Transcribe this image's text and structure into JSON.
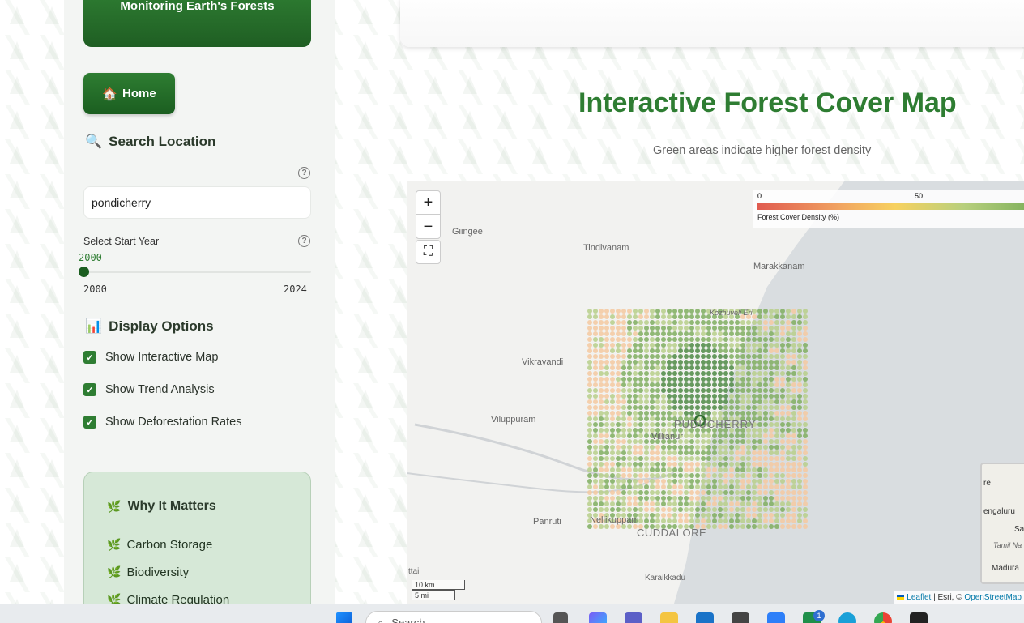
{
  "sidebar": {
    "brand_text": "Monitoring Earth's Forests",
    "home_button": {
      "icon": "house-icon",
      "label": "Home"
    },
    "search_section": {
      "icon": "magnifier-icon",
      "title": "Search Location",
      "value": "pondicherry"
    },
    "start_year": {
      "label": "Select Start Year",
      "value": "2000",
      "min": "2000",
      "max": "2024"
    },
    "display_options": {
      "icon": "bar-chart-icon",
      "title": "Display Options",
      "items": [
        {
          "label": "Show Interactive Map",
          "checked": true
        },
        {
          "label": "Show Trend Analysis",
          "checked": true
        },
        {
          "label": "Show Deforestation Rates",
          "checked": true
        }
      ]
    },
    "why_card": {
      "icon": "leaf-icon",
      "title": "Why It Matters",
      "items": [
        "Carbon Storage",
        "Biodiversity",
        "Climate Regulation"
      ]
    }
  },
  "main": {
    "title": "Interactive Forest Cover Map",
    "subtitle": "Green areas indicate higher forest density"
  },
  "map": {
    "zoom_in": "+",
    "zoom_out": "−",
    "fullscreen_icon": "fullscreen-icon",
    "legend": {
      "title": "Forest Cover Density (%)",
      "ticks": [
        "0",
        "50"
      ]
    },
    "places": [
      {
        "name": "Giingee"
      },
      {
        "name": "Tindivanam"
      },
      {
        "name": "Marakkanam"
      },
      {
        "name": "Kozhuveli Eri"
      },
      {
        "name": "Vikravandi"
      },
      {
        "name": "Viluppuram"
      },
      {
        "name": "PUDUCHERRY"
      },
      {
        "name": "Villianur"
      },
      {
        "name": "Panruti"
      },
      {
        "name": "Nellikuppam"
      },
      {
        "name": "CUDDALORE"
      },
      {
        "name": "Karaikkadu"
      },
      {
        "name": "ttai"
      }
    ],
    "scale": {
      "metric": "10 km",
      "imperial": "5 mi"
    },
    "attribution": {
      "leaflet": "Leaflet",
      "mid": " | Esri, © ",
      "osm": "OpenStreetMap"
    },
    "minimap_labels": [
      "re",
      "engaluru",
      "Sal",
      "Tamil Na",
      "Madura"
    ],
    "colors": {
      "high": "#4e8a44",
      "mid": "#b7cf8a",
      "low": "#f5c9a0",
      "sea": "#d9dde0"
    }
  },
  "taskbar": {
    "search_placeholder": "Search",
    "badge": "1"
  }
}
